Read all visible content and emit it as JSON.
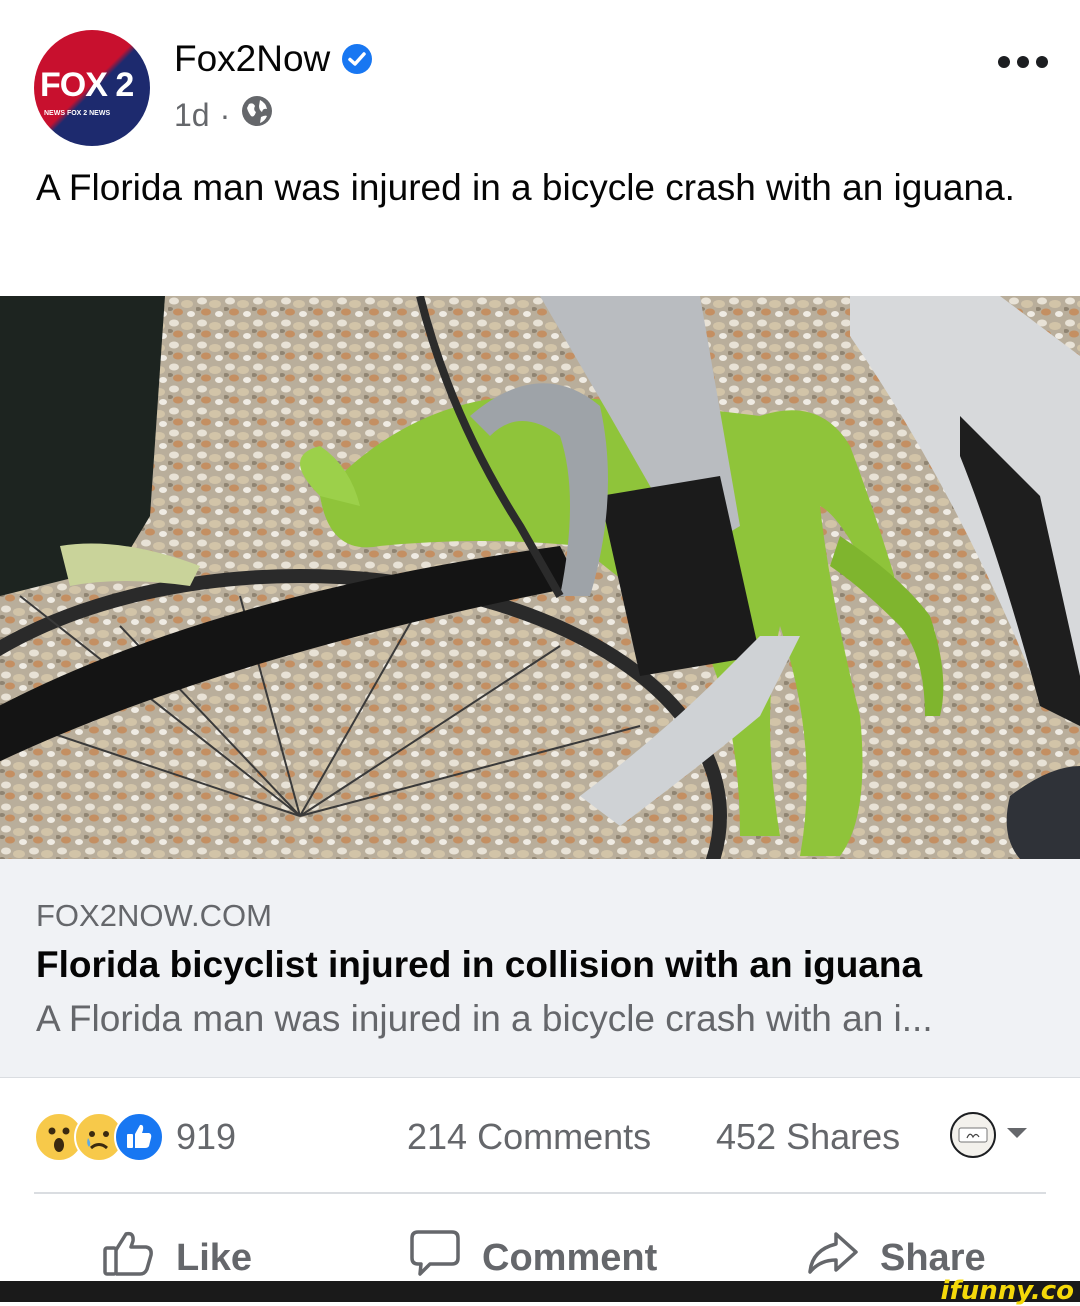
{
  "post": {
    "page_name": "Fox2Now",
    "time": "1d",
    "separator": "·",
    "caption": "A Florida man was injured in a bicycle crash with an iguana.",
    "avatar_logo_text": "FOX 2",
    "avatar_logo_sub": "NEWS    FOX 2 NEWS"
  },
  "link_preview": {
    "domain": "FOX2NOW.COM",
    "title": "Florida bicyclist injured in collision with an iguana",
    "description": "A Florida man was injured in a bicycle crash with an i..."
  },
  "reactions": {
    "icons": [
      "wow-icon",
      "sad-icon",
      "like-icon"
    ],
    "count": "919"
  },
  "stats": {
    "comments": "214 Comments",
    "shares": "452 Shares"
  },
  "actions": {
    "like": "Like",
    "comment": "Comment",
    "share": "Share"
  },
  "watermark": "ifunny.co",
  "colors": {
    "fb_blue": "#1877f2",
    "secondary_text": "#65676b",
    "link_box_bg": "#f0f2f5"
  }
}
